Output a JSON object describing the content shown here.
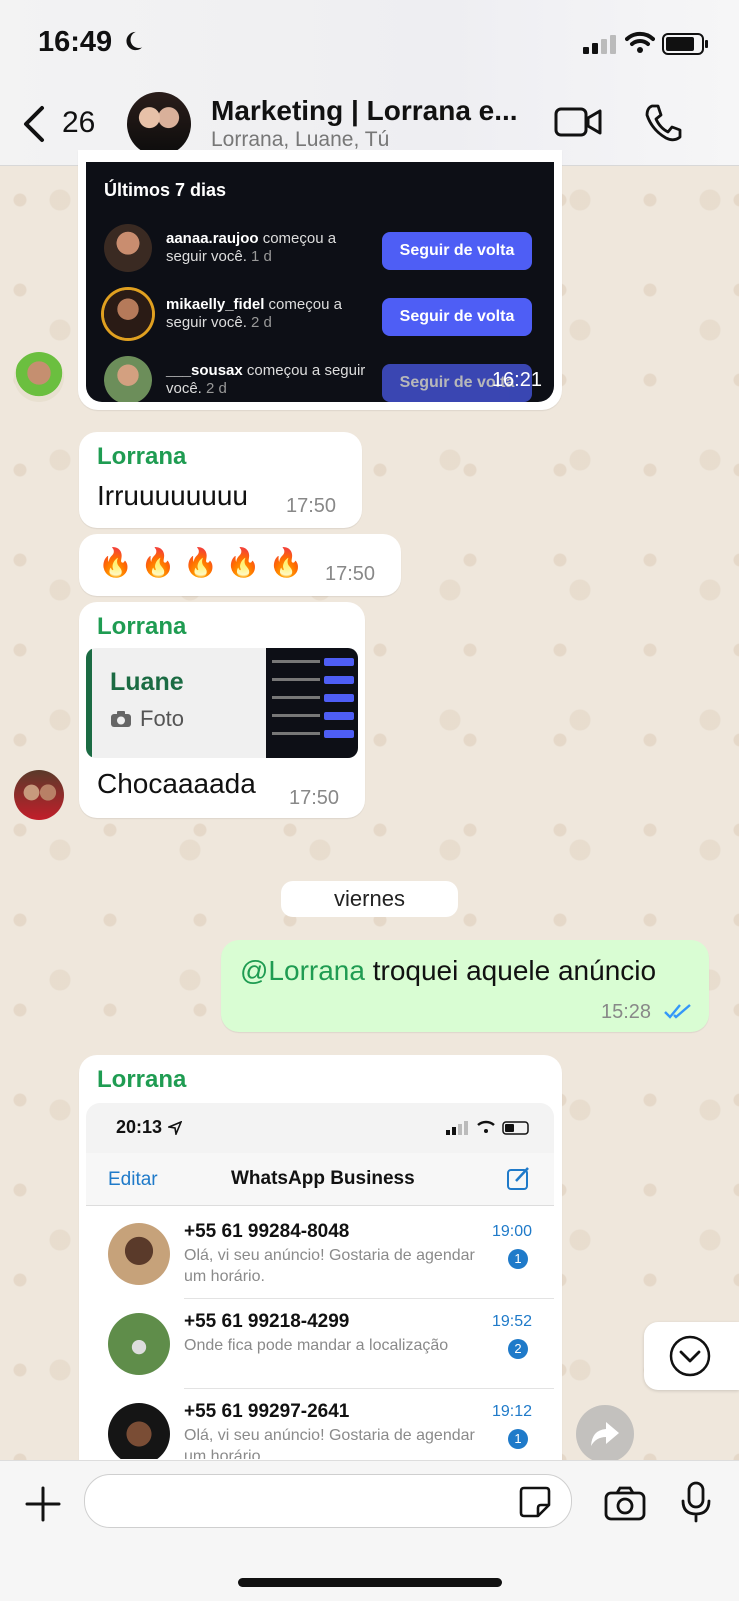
{
  "status_bar": {
    "time": "16:49"
  },
  "header": {
    "back_count": "26",
    "title": "Marketing | Lorrana e...",
    "subtitle": "Lorrana, Luane, Tú"
  },
  "messages": {
    "shot1": {
      "heading": "Últimos 7 dias",
      "rows": [
        {
          "user": "aanaa.raujoo",
          "text": " começou a seguir você.",
          "ago": " 1 d",
          "button": "Seguir de volta"
        },
        {
          "user": "mikaelly_fidel",
          "text": " começou a seguir você.",
          "ago": " 2 d",
          "button": "Seguir de volta"
        },
        {
          "user": "___sousax",
          "text": " começou a seguir você.",
          "ago": " 2 d",
          "button": "Seguir de volta"
        }
      ],
      "time": "16:21"
    },
    "m1": {
      "sender": "Lorrana",
      "text": "Irruuuuuuuu",
      "time": "17:50"
    },
    "m2": {
      "text": "🔥 🔥 🔥 🔥 🔥",
      "time": "17:50"
    },
    "m3": {
      "sender": "Lorrana",
      "reply_name": "Luane",
      "reply_type": "Foto",
      "text": "Chocaaaada",
      "time": "17:50"
    },
    "date_chip": "viernes",
    "m4": {
      "mention": "@Lorrana",
      "text": " troquei aquele anúncio",
      "time": "15:28"
    },
    "m5": {
      "sender": "Lorrana",
      "shot": {
        "time": "20:13",
        "edit": "Editar",
        "title": "WhatsApp Business",
        "chats": [
          {
            "number": "+55 61 99284-8048",
            "preview": "Olá, vi seu anúncio! Gostaria de agendar um horário.",
            "time": "19:00",
            "badge": "1"
          },
          {
            "number": "+55 61 99218-4299",
            "preview": "Onde fica  pode mandar a  localização",
            "time": "19:52",
            "badge": "2"
          },
          {
            "number": "+55 61 99297-2641",
            "preview": "Olá, vi seu anúncio! Gostaria de agendar um horário.",
            "time": "19:12",
            "badge": "1"
          }
        ]
      }
    }
  },
  "colors": {
    "sender": "#1f9c52",
    "outgoing": "#d9fdd3",
    "follow": "#4e5ef5",
    "link": "#1f7ac9"
  }
}
